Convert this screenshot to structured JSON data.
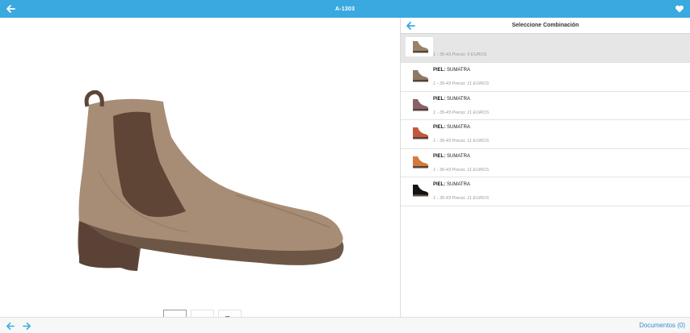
{
  "header": {
    "title": "A-1303",
    "back_icon": "arrow-left-icon",
    "favorite_icon": "heart-icon"
  },
  "gallery": {
    "main_alt": "Botín chelsea de piel marrón taupe",
    "thumbnails": [
      {
        "color": "#9b826a",
        "active": true
      },
      {
        "color": "#3a3a3a",
        "active": false
      },
      {
        "color": "#9a6a4c",
        "active": false
      }
    ]
  },
  "panel": {
    "title": "Seleccione Combinación",
    "back_icon": "arrow-left-icon",
    "items": [
      {
        "label": "",
        "value": "",
        "price": "1 - 35-43 Precio: 9 EUROS",
        "color": "#9b826a",
        "selected": true
      },
      {
        "label": "PIEL:",
        "value": " SUMATRA",
        "price": "1 - 35-43 Precio: 11 EUROS",
        "color": "#8f7864",
        "selected": false
      },
      {
        "label": "PIEL:",
        "value": " SUMATRA",
        "price": "1 - 35-43 Precio: 11 EUROS",
        "color": "#8a6166",
        "selected": false
      },
      {
        "label": "PIEL:",
        "value": " SUMATRA",
        "price": "1 - 35-43 Precio: 11 EUROS",
        "color": "#c4573b",
        "selected": false
      },
      {
        "label": "PIEL:",
        "value": " SUMATRA",
        "price": "1 - 35-43 Precio: 11 EUROS",
        "color": "#d37a3d",
        "selected": false
      },
      {
        "label": "PIEL:",
        "value": " SUMATRA",
        "price": "1 - 35-43 Precio: 11 EUROS",
        "color": "#141414",
        "selected": false
      }
    ]
  },
  "footer": {
    "prev_icon": "arrow-left-icon",
    "next_icon": "arrow-right-icon",
    "documents_label": "Documentos (0)"
  },
  "colors": {
    "accent": "#3aa9e0",
    "link": "#2c8fd1"
  }
}
